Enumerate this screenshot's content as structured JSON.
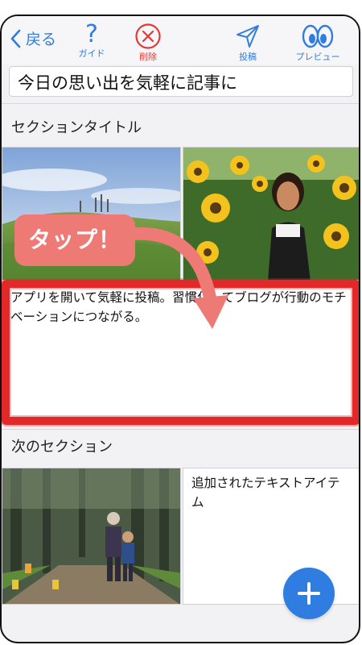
{
  "toolbar": {
    "back_label": "戻る",
    "guide_icon_glyph": "?",
    "guide_label": "ガイド",
    "delete_label": "削除",
    "post_label": "投稿",
    "preview_label": "プレビュー"
  },
  "post": {
    "title_value": "今日の思い出を気軽に記事に"
  },
  "sections": [
    {
      "title": "セクションタイトル",
      "text": "アプリを開いて気軽に投稿。習慣化してブログが行動のモチベーションにつながる。"
    },
    {
      "title": "次のセクション",
      "text": "追加されたテキストアイテム"
    }
  ],
  "overlay": {
    "tap_label": "タップ！"
  },
  "colors": {
    "accent": "#2f7de1",
    "delete": "#e03a3a",
    "highlight": "#e3282a",
    "tap_badge": "#ee7a76"
  }
}
